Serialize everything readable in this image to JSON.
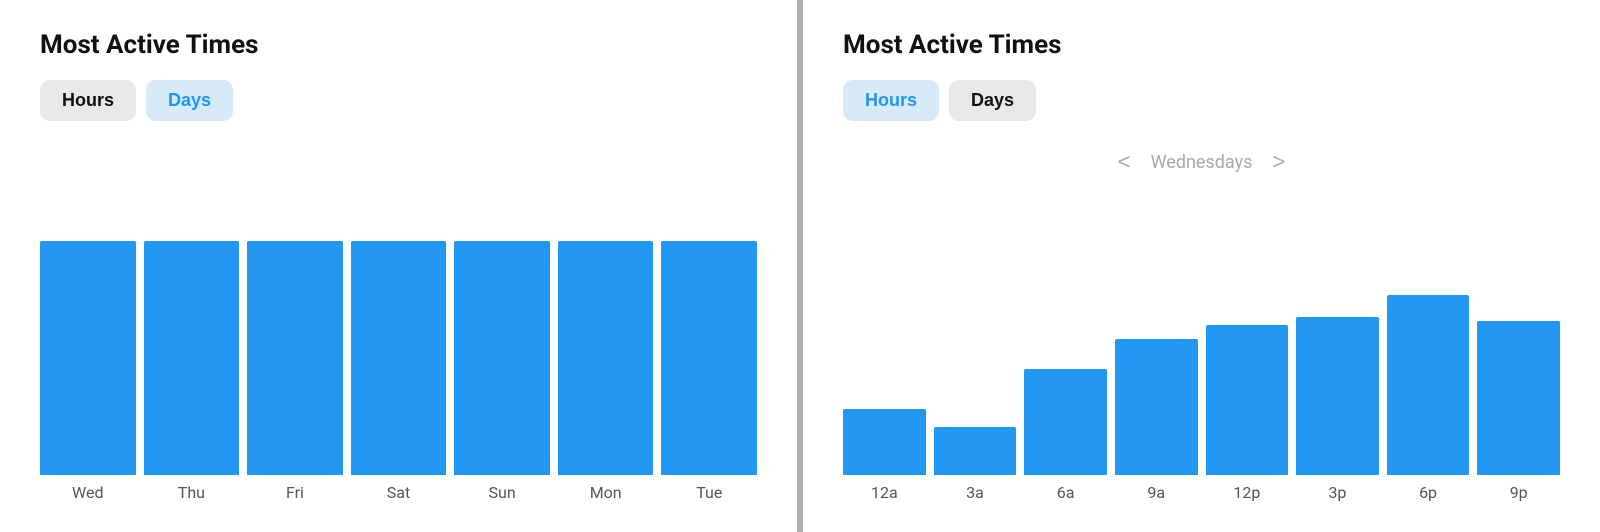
{
  "left": {
    "title": "Most Active Times",
    "toggleHours": "Hours",
    "toggleDays": "Days",
    "activeTab": "days",
    "bars": [
      {
        "label": "Wed",
        "heightPct": 90
      },
      {
        "label": "Thu",
        "heightPct": 90
      },
      {
        "label": "Fri",
        "heightPct": 90
      },
      {
        "label": "Sat",
        "heightPct": 90
      },
      {
        "label": "Sun",
        "heightPct": 90
      },
      {
        "label": "Mon",
        "heightPct": 90
      },
      {
        "label": "Tue",
        "heightPct": 90
      }
    ]
  },
  "right": {
    "title": "Most Active Times",
    "toggleHours": "Hours",
    "toggleDays": "Days",
    "activeTab": "hours",
    "dayNav": {
      "prev": "<",
      "next": ">",
      "current": "Wednesdays"
    },
    "bars": [
      {
        "label": "12a",
        "heightPct": 30
      },
      {
        "label": "3a",
        "heightPct": 22
      },
      {
        "label": "6a",
        "heightPct": 48
      },
      {
        "label": "9a",
        "heightPct": 62
      },
      {
        "label": "12p",
        "heightPct": 68
      },
      {
        "label": "3p",
        "heightPct": 72
      },
      {
        "label": "6p",
        "heightPct": 82
      },
      {
        "label": "9p",
        "heightPct": 70
      }
    ]
  }
}
